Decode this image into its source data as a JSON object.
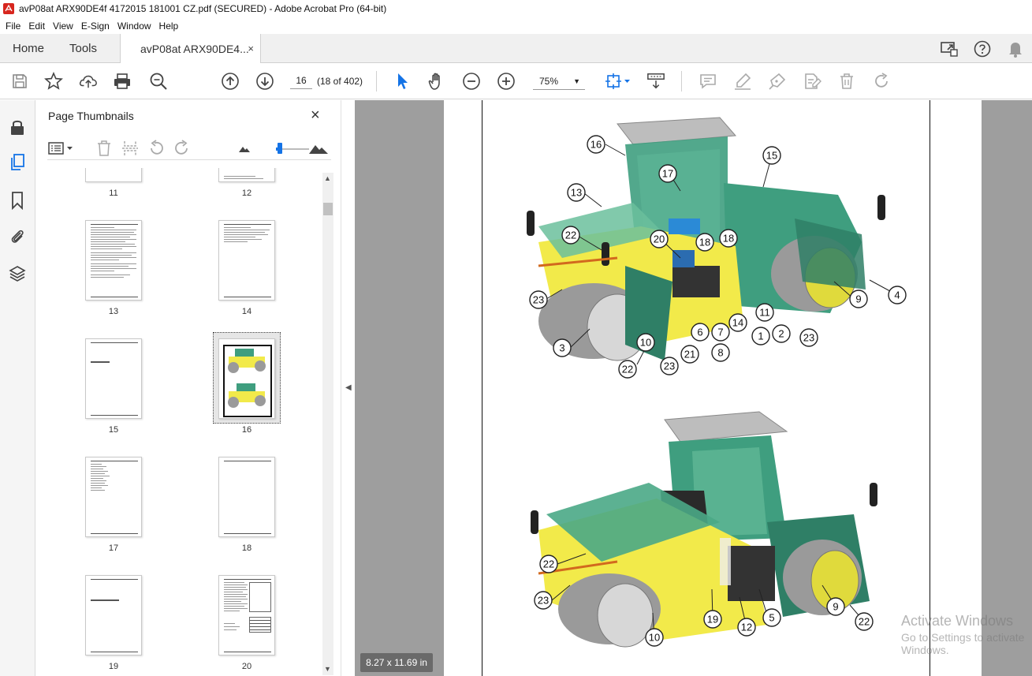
{
  "window": {
    "title": "avP08at ARX90DE4f 4172015 181001 CZ.pdf (SECURED) - Adobe Acrobat Pro (64-bit)"
  },
  "menu": [
    "File",
    "Edit",
    "View",
    "E-Sign",
    "Window",
    "Help"
  ],
  "tabs": {
    "home": "Home",
    "tools": "Tools",
    "document": "avP08at ARX90DE4...",
    "close": "×"
  },
  "toolbar": {
    "page_number": "16",
    "page_count": "(18 of 402)",
    "zoom": "75%"
  },
  "panel": {
    "title": "Page Thumbnails",
    "close": "×",
    "thumbnails": [
      {
        "label": "11"
      },
      {
        "label": "12"
      },
      {
        "label": "13"
      },
      {
        "label": "14"
      },
      {
        "label": "15",
        "heading": "5. Popis stroje"
      },
      {
        "label": "16",
        "selected": true
      },
      {
        "label": "17"
      },
      {
        "label": "18"
      },
      {
        "label": "19",
        "heading": "6. Specifikační příručka"
      },
      {
        "label": "20"
      }
    ]
  },
  "page_size": "8.27 x 11.69 in",
  "callouts_top": [
    "16",
    "15",
    "17",
    "13",
    "22",
    "20",
    "18",
    "18",
    "4",
    "9",
    "23",
    "11",
    "14",
    "2",
    "23",
    "6",
    "7",
    "1",
    "3",
    "10",
    "8",
    "21",
    "23",
    "22"
  ],
  "callouts_bottom": [
    "22",
    "23",
    "19",
    "12",
    "5",
    "9",
    "22",
    "10"
  ],
  "watermark": {
    "line1": "Activate Windows",
    "line2": "Go to Settings to activate Windows."
  },
  "colors": {
    "accent": "#1473e6",
    "machine_green": "#3f9e7f",
    "machine_yellow": "#f2ea4a",
    "drum_gray": "#9a9a9a"
  }
}
